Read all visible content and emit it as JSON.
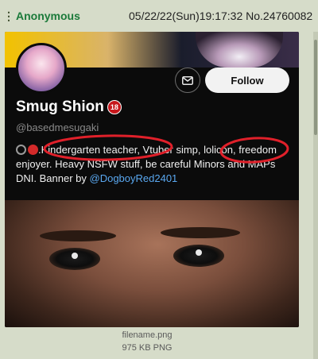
{
  "post": {
    "poster_name": "Anonymous",
    "datetime": "05/22/22(Sun)19:17:32",
    "post_number": "No.24760082",
    "menu_icon": "vertical-dots-icon"
  },
  "profile": {
    "display_name": "Smug Shion",
    "name_badge": "18",
    "handle": "@basedmesugaki",
    "follow_label": "Follow",
    "message_icon": "envelope-icon",
    "bio": {
      "part1": ".Kindergarten teacher",
      "part2": ", Vtuber simp, ",
      "part3": "lolicon,",
      "part4": " freedom enjoyer. Heavy NSFW stuff, be careful Minors and MAPs DNI. Banner by ",
      "link": "@DogboyRed2401"
    }
  },
  "file": {
    "name": "filename.png",
    "meta": "975 KB PNG"
  },
  "colors": {
    "annotation_red": "#e0202a",
    "poster_green": "#1b7a3a",
    "link_blue": "#5aa8f0"
  }
}
